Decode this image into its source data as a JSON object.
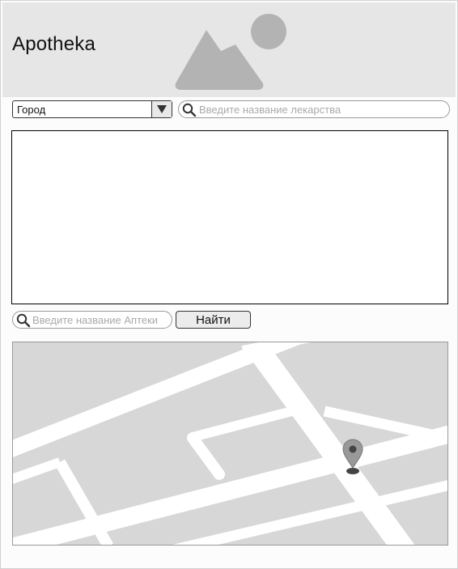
{
  "header": {
    "title": "Apotheka",
    "image_icon": "image-placeholder-icon"
  },
  "filters": {
    "city_select": {
      "value": "Город",
      "arrow_icon": "triangle-down-icon"
    },
    "drug_search": {
      "placeholder": "Введите название лекарства",
      "icon": "search-icon"
    }
  },
  "results": {
    "items": []
  },
  "pharmacy_search": {
    "placeholder": "Введите название Аптеки",
    "icon": "search-icon",
    "button_label": "Найти"
  },
  "map": {
    "marker_icon": "map-pin-icon"
  },
  "colors": {
    "header_bg": "#e6e6e6",
    "placeholder_gray": "#b3b3b3",
    "map_bg": "#d7d7d7",
    "road": "#ffffff"
  }
}
